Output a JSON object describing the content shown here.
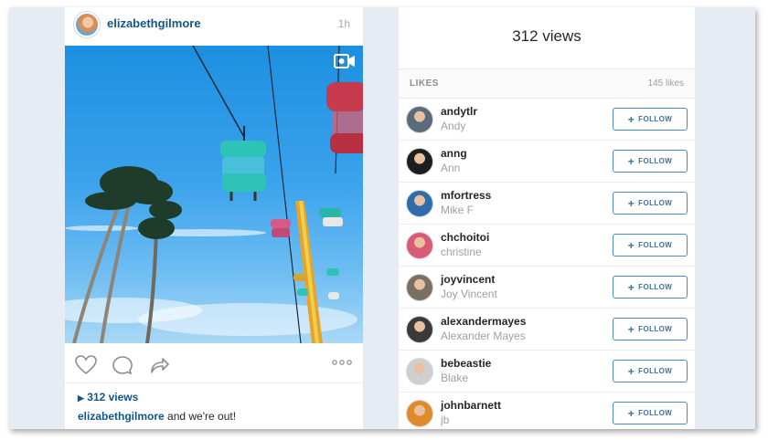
{
  "post": {
    "username": "elizabethgilmore",
    "time": "1h",
    "views": "312 views",
    "caption_text": "and we're out!",
    "icons": [
      "video-icon",
      "heart-icon",
      "comment-icon",
      "share-icon",
      "more-icon",
      "play-icon"
    ]
  },
  "panel": {
    "title": "312 views",
    "likes_label": "LIKES",
    "likes_count": "145 likes",
    "follow_label": "FOLLOW",
    "users": [
      {
        "username": "andytlr",
        "name": "Andy",
        "avatar_color": "#5b6b7c"
      },
      {
        "username": "anng",
        "name": "Ann",
        "avatar_color": "#1e1e1e"
      },
      {
        "username": "mfortress",
        "name": "Mike F",
        "avatar_color": "#2f6cab"
      },
      {
        "username": "chchoitoi",
        "name": "christine",
        "avatar_color": "#d95b78"
      },
      {
        "username": "joyvincent",
        "name": "Joy Vincent",
        "avatar_color": "#7a6f63"
      },
      {
        "username": "alexandermayes",
        "name": "Alexander Mayes",
        "avatar_color": "#3a3a3a"
      },
      {
        "username": "bebeastie",
        "name": "Blake",
        "avatar_color": "#cfcfcf"
      },
      {
        "username": "johnbarnett",
        "name": "jb",
        "avatar_color": "#e08a2a"
      }
    ]
  }
}
